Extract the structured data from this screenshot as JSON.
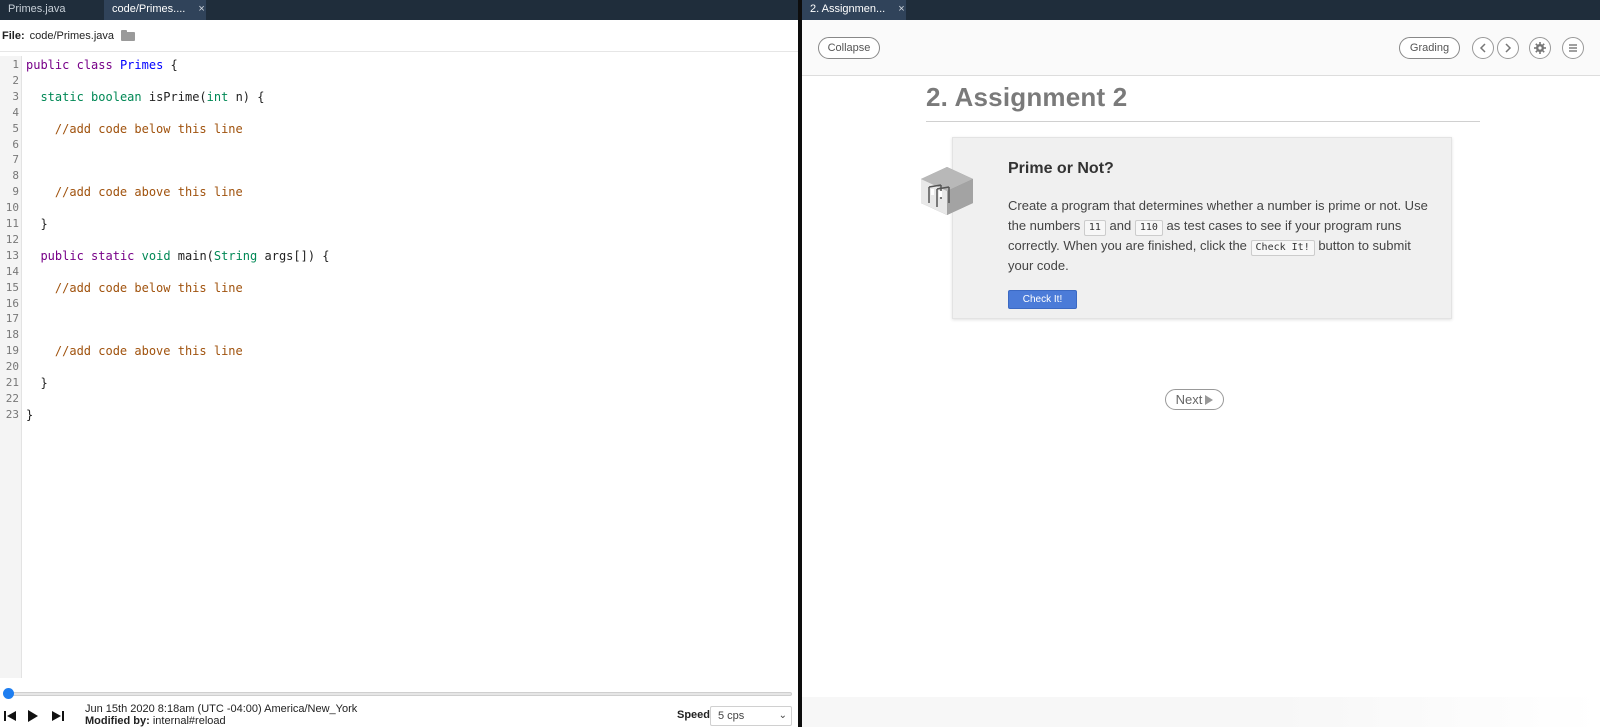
{
  "left": {
    "tabs": [
      {
        "label": "Primes.java",
        "active": false
      },
      {
        "label": "code/Primes....",
        "active": true,
        "close": "×"
      }
    ],
    "file_label": "File:",
    "file_path": "code/Primes.java",
    "code_lines": [
      {
        "n": "1",
        "tokens": [
          [
            "kw",
            "public"
          ],
          [
            "vr",
            " "
          ],
          [
            "kw",
            "class"
          ],
          [
            "vr",
            " "
          ],
          [
            "df",
            "Primes"
          ],
          [
            "vr",
            " {"
          ]
        ]
      },
      {
        "n": "2",
        "tokens": []
      },
      {
        "n": "3",
        "tokens": [
          [
            "vr",
            "  "
          ],
          [
            "ty",
            "static"
          ],
          [
            "vr",
            " "
          ],
          [
            "ty",
            "boolean"
          ],
          [
            "vr",
            " isPrime("
          ],
          [
            "ty",
            "int"
          ],
          [
            "vr",
            " n) {"
          ]
        ]
      },
      {
        "n": "4",
        "tokens": []
      },
      {
        "n": "5",
        "tokens": [
          [
            "vr",
            "    "
          ],
          [
            "cm",
            "//add code below this line"
          ]
        ]
      },
      {
        "n": "6",
        "tokens": []
      },
      {
        "n": "7",
        "tokens": []
      },
      {
        "n": "8",
        "tokens": []
      },
      {
        "n": "9",
        "tokens": [
          [
            "vr",
            "    "
          ],
          [
            "cm",
            "//add code above this line"
          ]
        ]
      },
      {
        "n": "10",
        "tokens": []
      },
      {
        "n": "11",
        "tokens": [
          [
            "vr",
            "  }"
          ]
        ]
      },
      {
        "n": "12",
        "tokens": []
      },
      {
        "n": "13",
        "tokens": [
          [
            "vr",
            "  "
          ],
          [
            "kw",
            "public"
          ],
          [
            "vr",
            " "
          ],
          [
            "kw",
            "static"
          ],
          [
            "vr",
            " "
          ],
          [
            "ty",
            "void"
          ],
          [
            "vr",
            " main("
          ],
          [
            "ty",
            "String"
          ],
          [
            "vr",
            " args[]) {"
          ]
        ]
      },
      {
        "n": "14",
        "tokens": []
      },
      {
        "n": "15",
        "tokens": [
          [
            "vr",
            "    "
          ],
          [
            "cm",
            "//add code below this line"
          ]
        ]
      },
      {
        "n": "16",
        "tokens": []
      },
      {
        "n": "17",
        "tokens": []
      },
      {
        "n": "18",
        "tokens": []
      },
      {
        "n": "19",
        "tokens": [
          [
            "vr",
            "    "
          ],
          [
            "cm",
            "//add code above this line"
          ]
        ]
      },
      {
        "n": "20",
        "tokens": []
      },
      {
        "n": "21",
        "tokens": [
          [
            "vr",
            "  }"
          ]
        ]
      },
      {
        "n": "22",
        "tokens": []
      },
      {
        "n": "23",
        "tokens": [
          [
            "vr",
            "}"
          ]
        ]
      }
    ],
    "playback": {
      "timestamp": "Jun 15th 2020 8:18am (UTC -04:00) America/New_York",
      "modified_label": "Modified by:",
      "modified_value": "internal#reload",
      "speed_label": "Speed",
      "speed_value": "5 cps",
      "position": 0
    }
  },
  "right": {
    "tabs": [
      {
        "label": "2. Assignmen...",
        "active": true,
        "close": "×"
      }
    ],
    "toolbar": {
      "collapse": "Collapse",
      "grading": "Grading"
    },
    "page_title": "2. Assignment 2",
    "card": {
      "title": "Prime or Not?",
      "text_1": "Create a program that determines whether a number is prime or not. Use the numbers ",
      "chip_1": "11",
      "text_2": " and ",
      "chip_2": "110",
      "text_3": " as test cases to see if your program runs correctly. When you are finished, click the ",
      "chip_3": "Check It!",
      "text_4": " button to submit your code.",
      "button": "Check It!"
    },
    "next": "Next"
  },
  "colors": {
    "tabbar": "#1f2d3b",
    "active_tab": "#30435a",
    "keyword": "#770088",
    "type": "#008855",
    "def": "#0000ff",
    "comment": "#a0520d",
    "check_button": "#4b7bd8"
  }
}
